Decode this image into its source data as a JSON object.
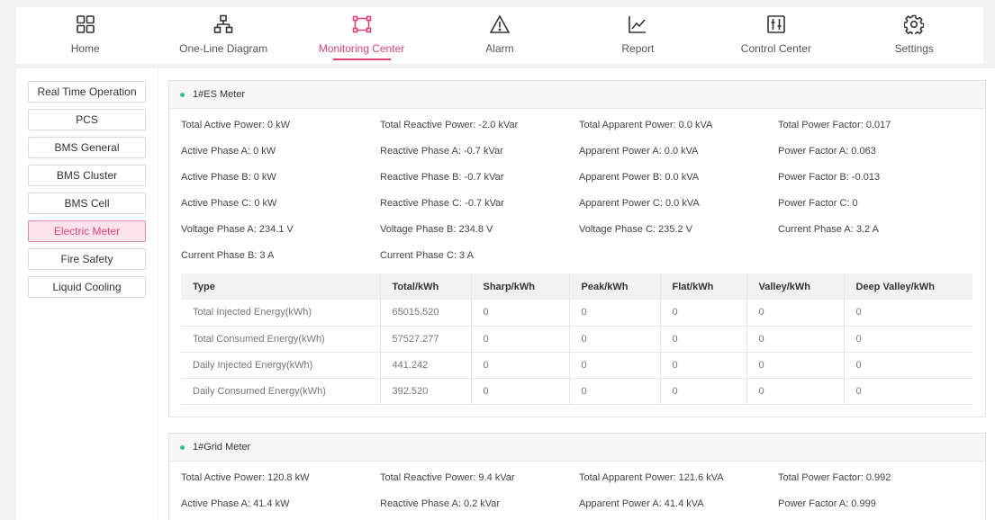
{
  "nav": [
    {
      "label": "Home",
      "icon": "grid-icon"
    },
    {
      "label": "One-Line Diagram",
      "icon": "hierarchy-icon"
    },
    {
      "label": "Monitoring Center",
      "icon": "frame-icon"
    },
    {
      "label": "Alarm",
      "icon": "warning-icon"
    },
    {
      "label": "Report",
      "icon": "chart-icon"
    },
    {
      "label": "Control Center",
      "icon": "sliders-icon"
    },
    {
      "label": "Settings",
      "icon": "gear-icon"
    }
  ],
  "nav_active": "Monitoring Center",
  "accent_color": "#d9437b",
  "sidebar": [
    "Real Time Operation",
    "PCS",
    "BMS General",
    "BMS Cluster",
    "BMS Cell",
    "Electric Meter",
    "Fire Safety",
    "Liquid Cooling"
  ],
  "sidebar_active": "Electric Meter",
  "es_meter": {
    "title": "1#ES Meter",
    "fields": [
      "Total Active Power:  0 kW",
      "Total Reactive Power:  -2.0 kVar",
      "Total Apparent Power:  0.0 kVA",
      "Total Power Factor:  0.017",
      "Active Phase A:  0 kW",
      "Reactive Phase A:  -0.7 kVar",
      "Apparent Power A:  0.0 kVA",
      "Power Factor A:  0.063",
      "Active Phase B:  0 kW",
      "Reactive Phase B:  -0.7 kVar",
      "Apparent Power B:  0.0 kVA",
      "Power Factor B:  -0.013",
      "Active Phase C:  0 kW",
      "Reactive Phase C:  -0.7 kVar",
      "Apparent Power C:  0.0 kVA",
      "Power Factor C:  0",
      "Voltage Phase A:  234.1 V",
      "Voltage Phase B:  234.8 V",
      "Voltage Phase C:  235.2 V",
      "Current Phase A:  3.2 A",
      "Current Phase B:  3 A",
      "Current Phase C:  3 A"
    ],
    "table_headers": [
      "Type",
      "Total/kWh",
      "Sharp/kWh",
      "Peak/kWh",
      "Flat/kWh",
      "Valley/kWh",
      "Deep Valley/kWh"
    ],
    "table_rows": [
      [
        "Total Injected Energy(kWh)",
        "65015.520",
        "0",
        "0",
        "0",
        "0",
        "0"
      ],
      [
        "Total Consumed Energy(kWh)",
        "57527.277",
        "0",
        "0",
        "0",
        "0",
        "0"
      ],
      [
        "Daily Injected Energy(kWh)",
        "441.242",
        "0",
        "0",
        "0",
        "0",
        "0"
      ],
      [
        "Daily Consumed Energy(kWh)",
        "392.520",
        "0",
        "0",
        "0",
        "0",
        "0"
      ]
    ]
  },
  "grid_meter": {
    "title": "1#Grid Meter",
    "fields": [
      "Total Active Power:  120.8 kW",
      "Total Reactive Power:  9.4 kVar",
      "Total Apparent Power:  121.6 kVA",
      "Total Power Factor:  0.992",
      "Active Phase A:  41.4 kW",
      "Reactive Phase A:  0.2 kVar",
      "Apparent Power A:  41.4 kVA",
      "Power Factor A:  0.999"
    ]
  }
}
